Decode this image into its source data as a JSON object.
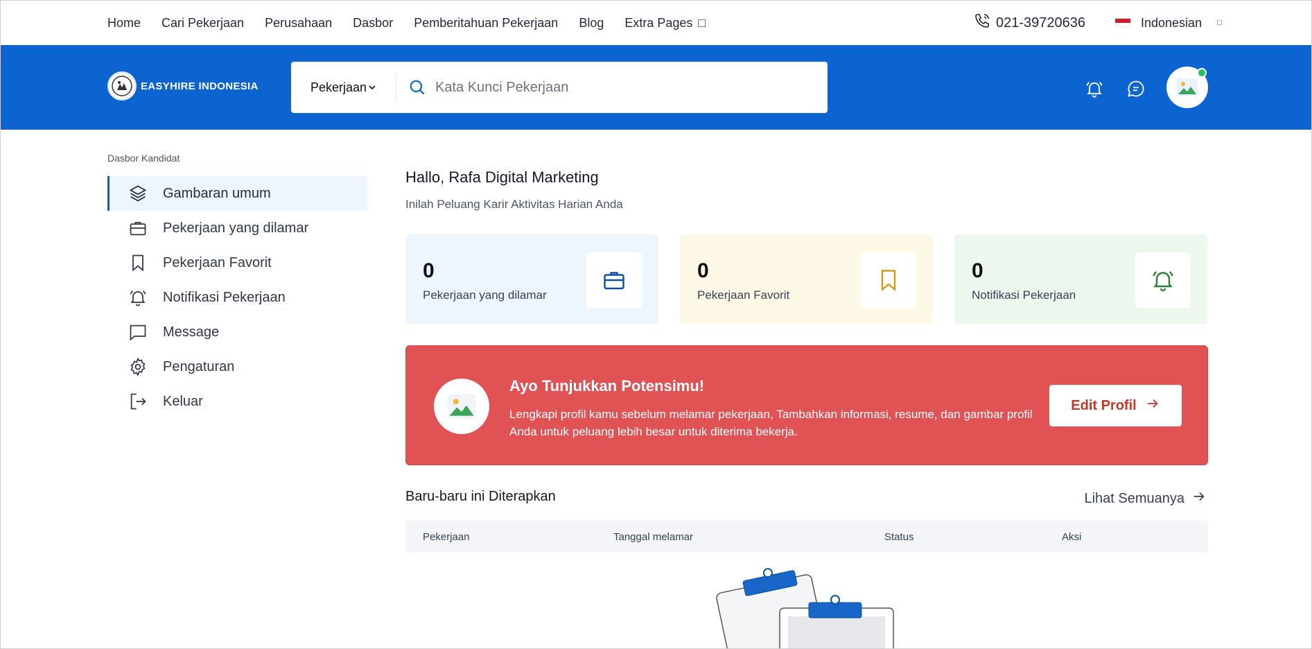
{
  "topnav": {
    "links": [
      "Home",
      "Cari Pekerjaan",
      "Perusahaan",
      "Dasbor",
      "Pemberitahuan Pekerjaan",
      "Blog",
      "Extra Pages"
    ],
    "phone": "021-39720636",
    "language": "Indonesian"
  },
  "header": {
    "logo_text": "EASYHIRE INDONESIA",
    "search_category": "Pekerjaan",
    "search_placeholder": "Kata Kunci Pekerjaan"
  },
  "sidebar": {
    "title": "Dasbor Kandidat",
    "items": [
      {
        "label": "Gambaran umum",
        "icon": "layers-icon"
      },
      {
        "label": "Pekerjaan yang dilamar",
        "icon": "briefcase-icon"
      },
      {
        "label": "Pekerjaan Favorit",
        "icon": "bookmark-icon"
      },
      {
        "label": "Notifikasi Pekerjaan",
        "icon": "bell-icon"
      },
      {
        "label": "Message",
        "icon": "message-icon"
      },
      {
        "label": "Pengaturan",
        "icon": "gear-icon"
      },
      {
        "label": "Keluar",
        "icon": "logout-icon"
      }
    ]
  },
  "main": {
    "greeting": "Hallo, Rafa Digital Marketing",
    "subtitle": "Inilah Peluang Karir Aktivitas Harian Anda",
    "cards": [
      {
        "value": "0",
        "label": "Pekerjaan yang dilamar",
        "bg": "#edf5fe",
        "icon_color": "#0b4f9e"
      },
      {
        "value": "0",
        "label": "Pekerjaan Favorit",
        "bg": "#fef8e7",
        "icon_color": "#d39a16"
      },
      {
        "value": "0",
        "label": "Notifikasi Pekerjaan",
        "bg": "#ecf8ee",
        "icon_color": "#2f7d3a"
      }
    ],
    "banner": {
      "title": "Ayo Tunjukkan Potensimu!",
      "description": "Lengkapi profil kamu sebelum melamar pekerjaan, Tambahkan informasi, resume, dan gambar profil Anda untuk peluang lebih besar untuk diterima bekerja.",
      "button": "Edit Profil",
      "color": "#e05254"
    },
    "recent_title": "Baru-baru ini Diterapkan",
    "see_all": "Lihat Semuanya",
    "table_headers": [
      "Pekerjaan",
      "Tanggal melamar",
      "Status",
      "Aksi"
    ]
  },
  "colors": {
    "brand_blue": "#0b64d0"
  }
}
